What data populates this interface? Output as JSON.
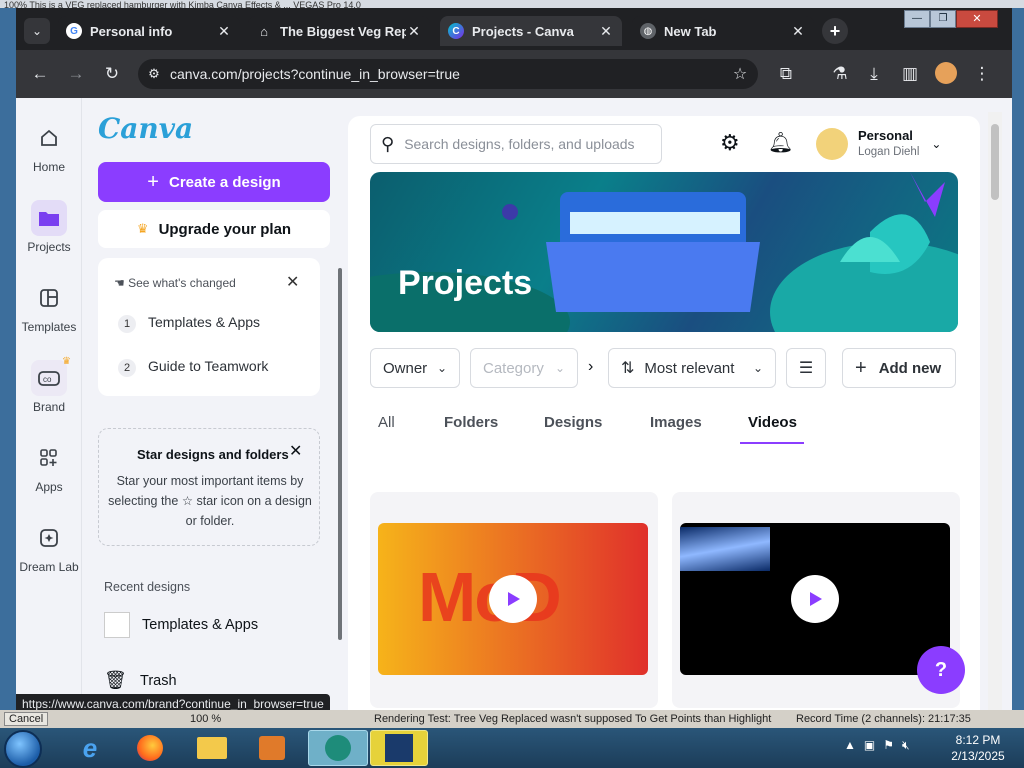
{
  "background_app": {
    "top_text": "100%  This is a VEG replaced hamburger with Kimba Canva Effects & ...  VEGAS Pro 14.0",
    "bottom_left": "Cancel",
    "bottom_zoom": "100 %",
    "bottom_status": "Rendering Test: Tree Veg Replaced wasn't supposed To Get Points than Highlight",
    "bottom_record": "Record Time (2 channels): 21:17:35"
  },
  "browser": {
    "tabs": [
      {
        "title": "Personal info",
        "icon": "google-icon",
        "active": false
      },
      {
        "title": "The Biggest Veg Repla",
        "icon": "bank-icon",
        "active": false
      },
      {
        "title": "Projects - Canva",
        "icon": "canva-icon",
        "active": true
      },
      {
        "title": "New Tab",
        "icon": "globe-icon",
        "active": false
      }
    ],
    "new_tab_symbol": "+",
    "tab_close_symbol": "✕",
    "url": "canva.com/projects?continue_in_browser=true",
    "window_controls": {
      "minimize": "—",
      "maximize": "❐",
      "close": "✕"
    },
    "status_url": "https://www.canva.com/brand?continue_in_browser=true"
  },
  "rail": {
    "items": [
      {
        "label": "Home",
        "icon": "home-icon"
      },
      {
        "label": "Projects",
        "icon": "folder-icon"
      },
      {
        "label": "Templates",
        "icon": "templates-icon"
      },
      {
        "label": "Brand",
        "icon": "brand-icon"
      },
      {
        "label": "Apps",
        "icon": "apps-icon"
      },
      {
        "label": "Dream Lab",
        "icon": "dream-lab-icon"
      }
    ]
  },
  "sidebar": {
    "logo": "Canva",
    "create_label": "Create a design",
    "upgrade_label": "Upgrade your plan",
    "whats_new": {
      "title": "See what's changed",
      "items": [
        {
          "num": "1",
          "label": "Templates & Apps"
        },
        {
          "num": "2",
          "label": "Guide to Teamwork"
        }
      ]
    },
    "star_tip": {
      "title": "Star designs and folders",
      "body": "Star your most important items by selecting the ☆ star icon on a design or folder."
    },
    "recent_heading": "Recent designs",
    "recent_items": [
      {
        "label": "Templates & Apps"
      }
    ],
    "trash_label": "Trash"
  },
  "main": {
    "search_placeholder": "Search designs, folders, and uploads",
    "account": {
      "name": "Personal",
      "user": "Logan Diehl"
    },
    "banner_title": "Projects",
    "filters": {
      "owner": "Owner",
      "category": "Category",
      "sort": "Most relevant",
      "add_new": "Add new"
    },
    "tabs": [
      "All",
      "Folders",
      "Designs",
      "Images",
      "Videos"
    ],
    "active_tab": "Videos",
    "videos": [
      {
        "thumb_text": "McD",
        "thumb_colors": [
          "#f6b31a",
          "#e0302b"
        ]
      },
      {
        "thumb_text": "",
        "thumb_colors": [
          "#000000",
          "#1a3b7a"
        ]
      }
    ],
    "help_label": "?"
  },
  "taskbar": {
    "time": "8:12 PM",
    "date": "2/13/2025"
  },
  "colors": {
    "accent": "#8b3dff",
    "chrome_dark": "#202124",
    "chrome_mid": "#35363a"
  }
}
